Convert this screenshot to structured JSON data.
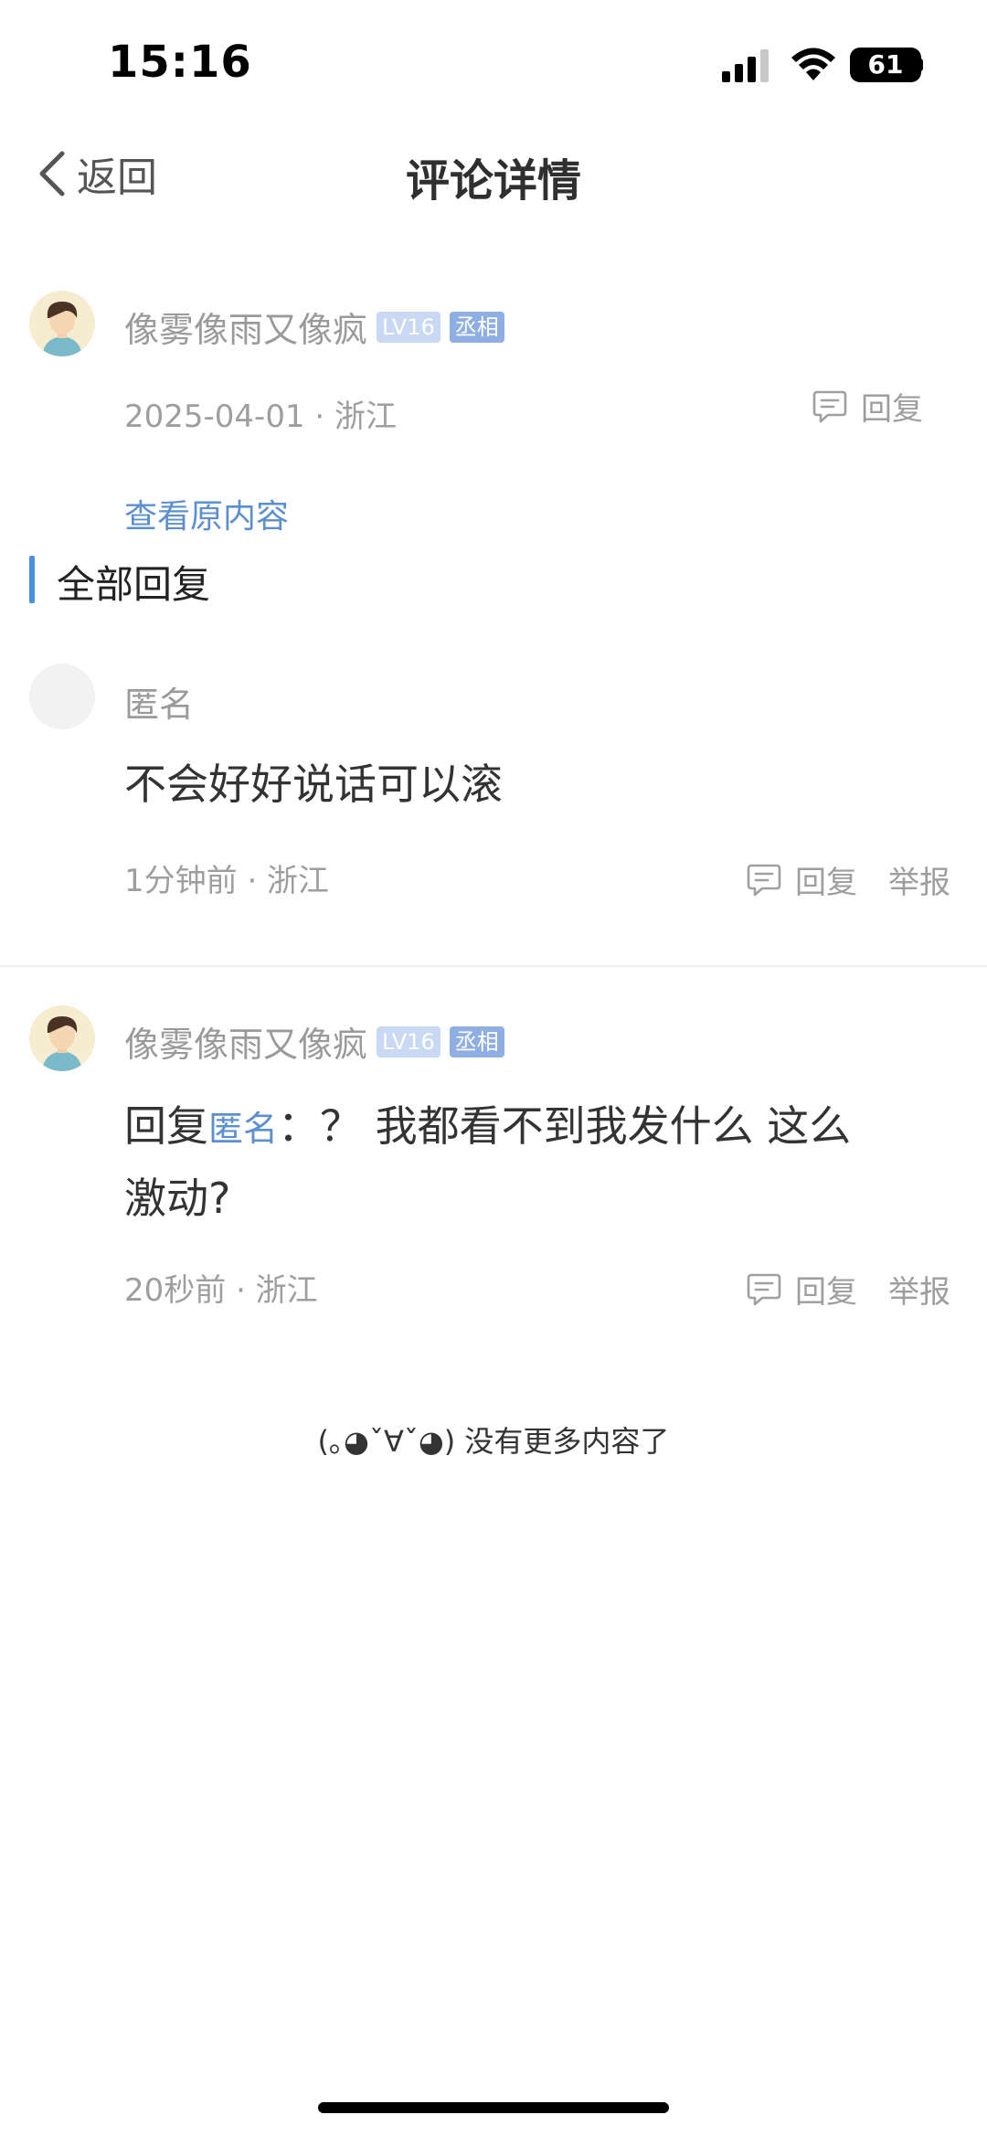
{
  "status_bar": {
    "time": "15:16",
    "battery": "61"
  },
  "nav": {
    "back_label": "返回",
    "title": "评论详情"
  },
  "main_comment": {
    "username": "像雾像雨又像疯",
    "level": "LV16",
    "title_badge": "丞相",
    "meta": "2025-04-01 · 浙江",
    "reply_label": "回复",
    "view_original": "查看原内容"
  },
  "section_title": "全部回复",
  "replies": [
    {
      "username": "匿名",
      "text": "不会好好说话可以滚",
      "meta": "1分钟前 · 浙江",
      "reply_label": "回复",
      "report_label": "举报"
    },
    {
      "username": "像雾像雨又像疯",
      "level": "LV16",
      "title_badge": "丞相",
      "text_prefix": "回复",
      "mention": "匿名",
      "text_line1": "：？ 我都看不到我发什么 这么",
      "text_line2": "激动?",
      "meta": "20秒前 · 浙江",
      "reply_label": "回复",
      "report_label": "举报"
    }
  ],
  "end_text": "(｡◕ˇ∀ˇ◕) 没有更多内容了",
  "colors": {
    "link": "#5b8fd0",
    "accent_bar": "#4a8fe3",
    "meta": "#9e9e9e"
  }
}
